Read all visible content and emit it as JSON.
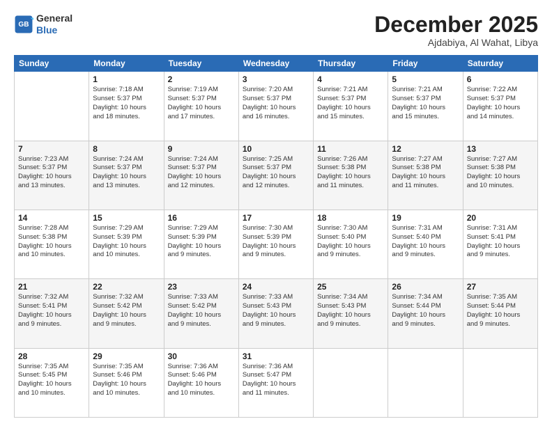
{
  "header": {
    "logo_line1": "General",
    "logo_line2": "Blue",
    "month_title": "December 2025",
    "location": "Ajdabiya, Al Wahat, Libya"
  },
  "weekdays": [
    "Sunday",
    "Monday",
    "Tuesday",
    "Wednesday",
    "Thursday",
    "Friday",
    "Saturday"
  ],
  "weeks": [
    [
      {
        "day": "",
        "info": ""
      },
      {
        "day": "1",
        "info": "Sunrise: 7:18 AM\nSunset: 5:37 PM\nDaylight: 10 hours\nand 18 minutes."
      },
      {
        "day": "2",
        "info": "Sunrise: 7:19 AM\nSunset: 5:37 PM\nDaylight: 10 hours\nand 17 minutes."
      },
      {
        "day": "3",
        "info": "Sunrise: 7:20 AM\nSunset: 5:37 PM\nDaylight: 10 hours\nand 16 minutes."
      },
      {
        "day": "4",
        "info": "Sunrise: 7:21 AM\nSunset: 5:37 PM\nDaylight: 10 hours\nand 15 minutes."
      },
      {
        "day": "5",
        "info": "Sunrise: 7:21 AM\nSunset: 5:37 PM\nDaylight: 10 hours\nand 15 minutes."
      },
      {
        "day": "6",
        "info": "Sunrise: 7:22 AM\nSunset: 5:37 PM\nDaylight: 10 hours\nand 14 minutes."
      }
    ],
    [
      {
        "day": "7",
        "info": "Sunrise: 7:23 AM\nSunset: 5:37 PM\nDaylight: 10 hours\nand 13 minutes."
      },
      {
        "day": "8",
        "info": "Sunrise: 7:24 AM\nSunset: 5:37 PM\nDaylight: 10 hours\nand 13 minutes."
      },
      {
        "day": "9",
        "info": "Sunrise: 7:24 AM\nSunset: 5:37 PM\nDaylight: 10 hours\nand 12 minutes."
      },
      {
        "day": "10",
        "info": "Sunrise: 7:25 AM\nSunset: 5:37 PM\nDaylight: 10 hours\nand 12 minutes."
      },
      {
        "day": "11",
        "info": "Sunrise: 7:26 AM\nSunset: 5:38 PM\nDaylight: 10 hours\nand 11 minutes."
      },
      {
        "day": "12",
        "info": "Sunrise: 7:27 AM\nSunset: 5:38 PM\nDaylight: 10 hours\nand 11 minutes."
      },
      {
        "day": "13",
        "info": "Sunrise: 7:27 AM\nSunset: 5:38 PM\nDaylight: 10 hours\nand 10 minutes."
      }
    ],
    [
      {
        "day": "14",
        "info": "Sunrise: 7:28 AM\nSunset: 5:38 PM\nDaylight: 10 hours\nand 10 minutes."
      },
      {
        "day": "15",
        "info": "Sunrise: 7:29 AM\nSunset: 5:39 PM\nDaylight: 10 hours\nand 10 minutes."
      },
      {
        "day": "16",
        "info": "Sunrise: 7:29 AM\nSunset: 5:39 PM\nDaylight: 10 hours\nand 9 minutes."
      },
      {
        "day": "17",
        "info": "Sunrise: 7:30 AM\nSunset: 5:39 PM\nDaylight: 10 hours\nand 9 minutes."
      },
      {
        "day": "18",
        "info": "Sunrise: 7:30 AM\nSunset: 5:40 PM\nDaylight: 10 hours\nand 9 minutes."
      },
      {
        "day": "19",
        "info": "Sunrise: 7:31 AM\nSunset: 5:40 PM\nDaylight: 10 hours\nand 9 minutes."
      },
      {
        "day": "20",
        "info": "Sunrise: 7:31 AM\nSunset: 5:41 PM\nDaylight: 10 hours\nand 9 minutes."
      }
    ],
    [
      {
        "day": "21",
        "info": "Sunrise: 7:32 AM\nSunset: 5:41 PM\nDaylight: 10 hours\nand 9 minutes."
      },
      {
        "day": "22",
        "info": "Sunrise: 7:32 AM\nSunset: 5:42 PM\nDaylight: 10 hours\nand 9 minutes."
      },
      {
        "day": "23",
        "info": "Sunrise: 7:33 AM\nSunset: 5:42 PM\nDaylight: 10 hours\nand 9 minutes."
      },
      {
        "day": "24",
        "info": "Sunrise: 7:33 AM\nSunset: 5:43 PM\nDaylight: 10 hours\nand 9 minutes."
      },
      {
        "day": "25",
        "info": "Sunrise: 7:34 AM\nSunset: 5:43 PM\nDaylight: 10 hours\nand 9 minutes."
      },
      {
        "day": "26",
        "info": "Sunrise: 7:34 AM\nSunset: 5:44 PM\nDaylight: 10 hours\nand 9 minutes."
      },
      {
        "day": "27",
        "info": "Sunrise: 7:35 AM\nSunset: 5:44 PM\nDaylight: 10 hours\nand 9 minutes."
      }
    ],
    [
      {
        "day": "28",
        "info": "Sunrise: 7:35 AM\nSunset: 5:45 PM\nDaylight: 10 hours\nand 10 minutes."
      },
      {
        "day": "29",
        "info": "Sunrise: 7:35 AM\nSunset: 5:46 PM\nDaylight: 10 hours\nand 10 minutes."
      },
      {
        "day": "30",
        "info": "Sunrise: 7:36 AM\nSunset: 5:46 PM\nDaylight: 10 hours\nand 10 minutes."
      },
      {
        "day": "31",
        "info": "Sunrise: 7:36 AM\nSunset: 5:47 PM\nDaylight: 10 hours\nand 11 minutes."
      },
      {
        "day": "",
        "info": ""
      },
      {
        "day": "",
        "info": ""
      },
      {
        "day": "",
        "info": ""
      }
    ]
  ]
}
